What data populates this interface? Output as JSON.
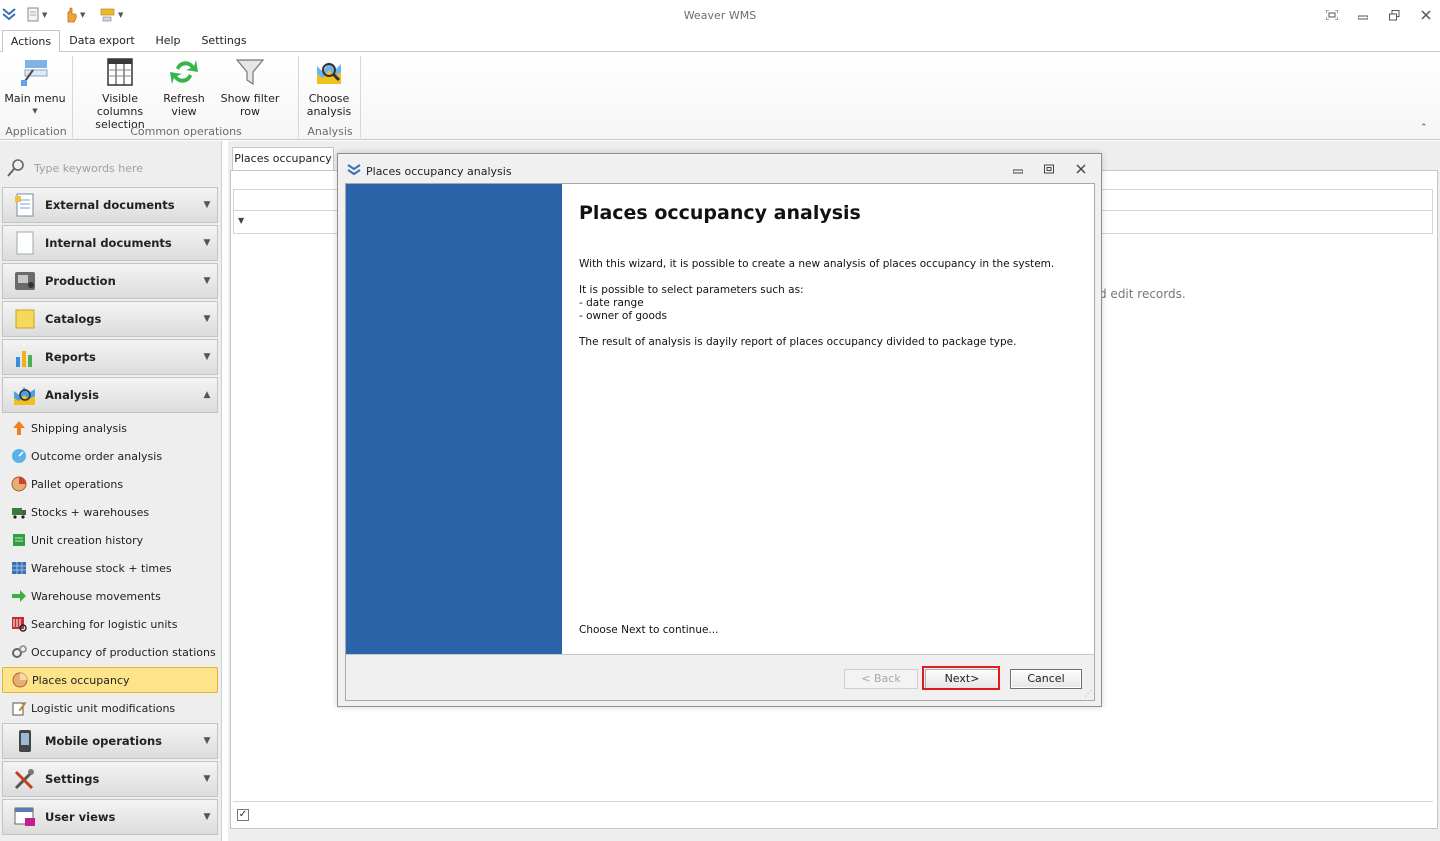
{
  "app": {
    "title": "Weaver WMS"
  },
  "ribbon": {
    "tabs": [
      "Actions",
      "Data export",
      "Help",
      "Settings"
    ],
    "buttons": {
      "main_menu": "Main menu",
      "visible_columns_l1": "Visible columns",
      "visible_columns_l2": "selection",
      "refresh_l1": "Refresh",
      "refresh_l2": "view",
      "show_filter_row": "Show filter row",
      "choose_analysis_l1": "Choose",
      "choose_analysis_l2": "analysis"
    },
    "groups": {
      "application": "Application",
      "common": "Common operations",
      "analysis": "Analysis"
    }
  },
  "sidebar": {
    "search_placeholder": "Type keywords here",
    "groups_top": [
      {
        "label": "External documents",
        "icon": "document-icon"
      },
      {
        "label": "Internal documents",
        "icon": "blank-document-icon"
      },
      {
        "label": "Production",
        "icon": "machine-icon"
      },
      {
        "label": "Catalogs",
        "icon": "catalog-icon"
      },
      {
        "label": "Reports",
        "icon": "chart-icon"
      },
      {
        "label": "Analysis",
        "icon": "analysis-icon"
      }
    ],
    "items": [
      {
        "label": "Shipping analysis",
        "icon": "arrow-up-icon"
      },
      {
        "label": "Outcome order analysis",
        "icon": "gauge-icon"
      },
      {
        "label": "Pallet operations",
        "icon": "pallet-icon"
      },
      {
        "label": "Stocks + warehouses",
        "icon": "truck-icon"
      },
      {
        "label": "Unit creation history",
        "icon": "history-icon"
      },
      {
        "label": "Warehouse stock + times",
        "icon": "grid-icon"
      },
      {
        "label": "Warehouse movements",
        "icon": "arrow-right-icon"
      },
      {
        "label": "Searching for logistic units",
        "icon": "barcode-search-icon"
      },
      {
        "label": "Occupancy of production stations",
        "icon": "gears-icon"
      },
      {
        "label": "Places occupancy",
        "icon": "pie-icon"
      },
      {
        "label": "Logistic unit modifications",
        "icon": "edit-icon"
      }
    ],
    "groups_bottom": [
      {
        "label": "Mobile operations",
        "icon": "mobile-icon"
      },
      {
        "label": "Settings",
        "icon": "tools-icon"
      },
      {
        "label": "User views",
        "icon": "user-view-icon"
      }
    ]
  },
  "document": {
    "tab_label": "Places occupancy",
    "empty_text": "d  edit records."
  },
  "dialog": {
    "title": "Places occupancy analysis",
    "heading": "Places occupancy analysis",
    "intro": "With this wizard, it is possible to create a new analysis of places occupancy in the system.",
    "params_intro": "It is possible to select parameters such as:",
    "param_1": "- date range",
    "param_2": "- owner of goods",
    "result": "The result of analysis is dayily report of places occupancy divided to package type.",
    "continue_hint": "Choose Next to continue...",
    "back_label": "< Back",
    "next_label": "Next>",
    "cancel_label": "Cancel"
  },
  "colors": {
    "wizard_side": "#2a63a8",
    "selected_item": "#fde48a",
    "highlight": "#e01b1b"
  }
}
